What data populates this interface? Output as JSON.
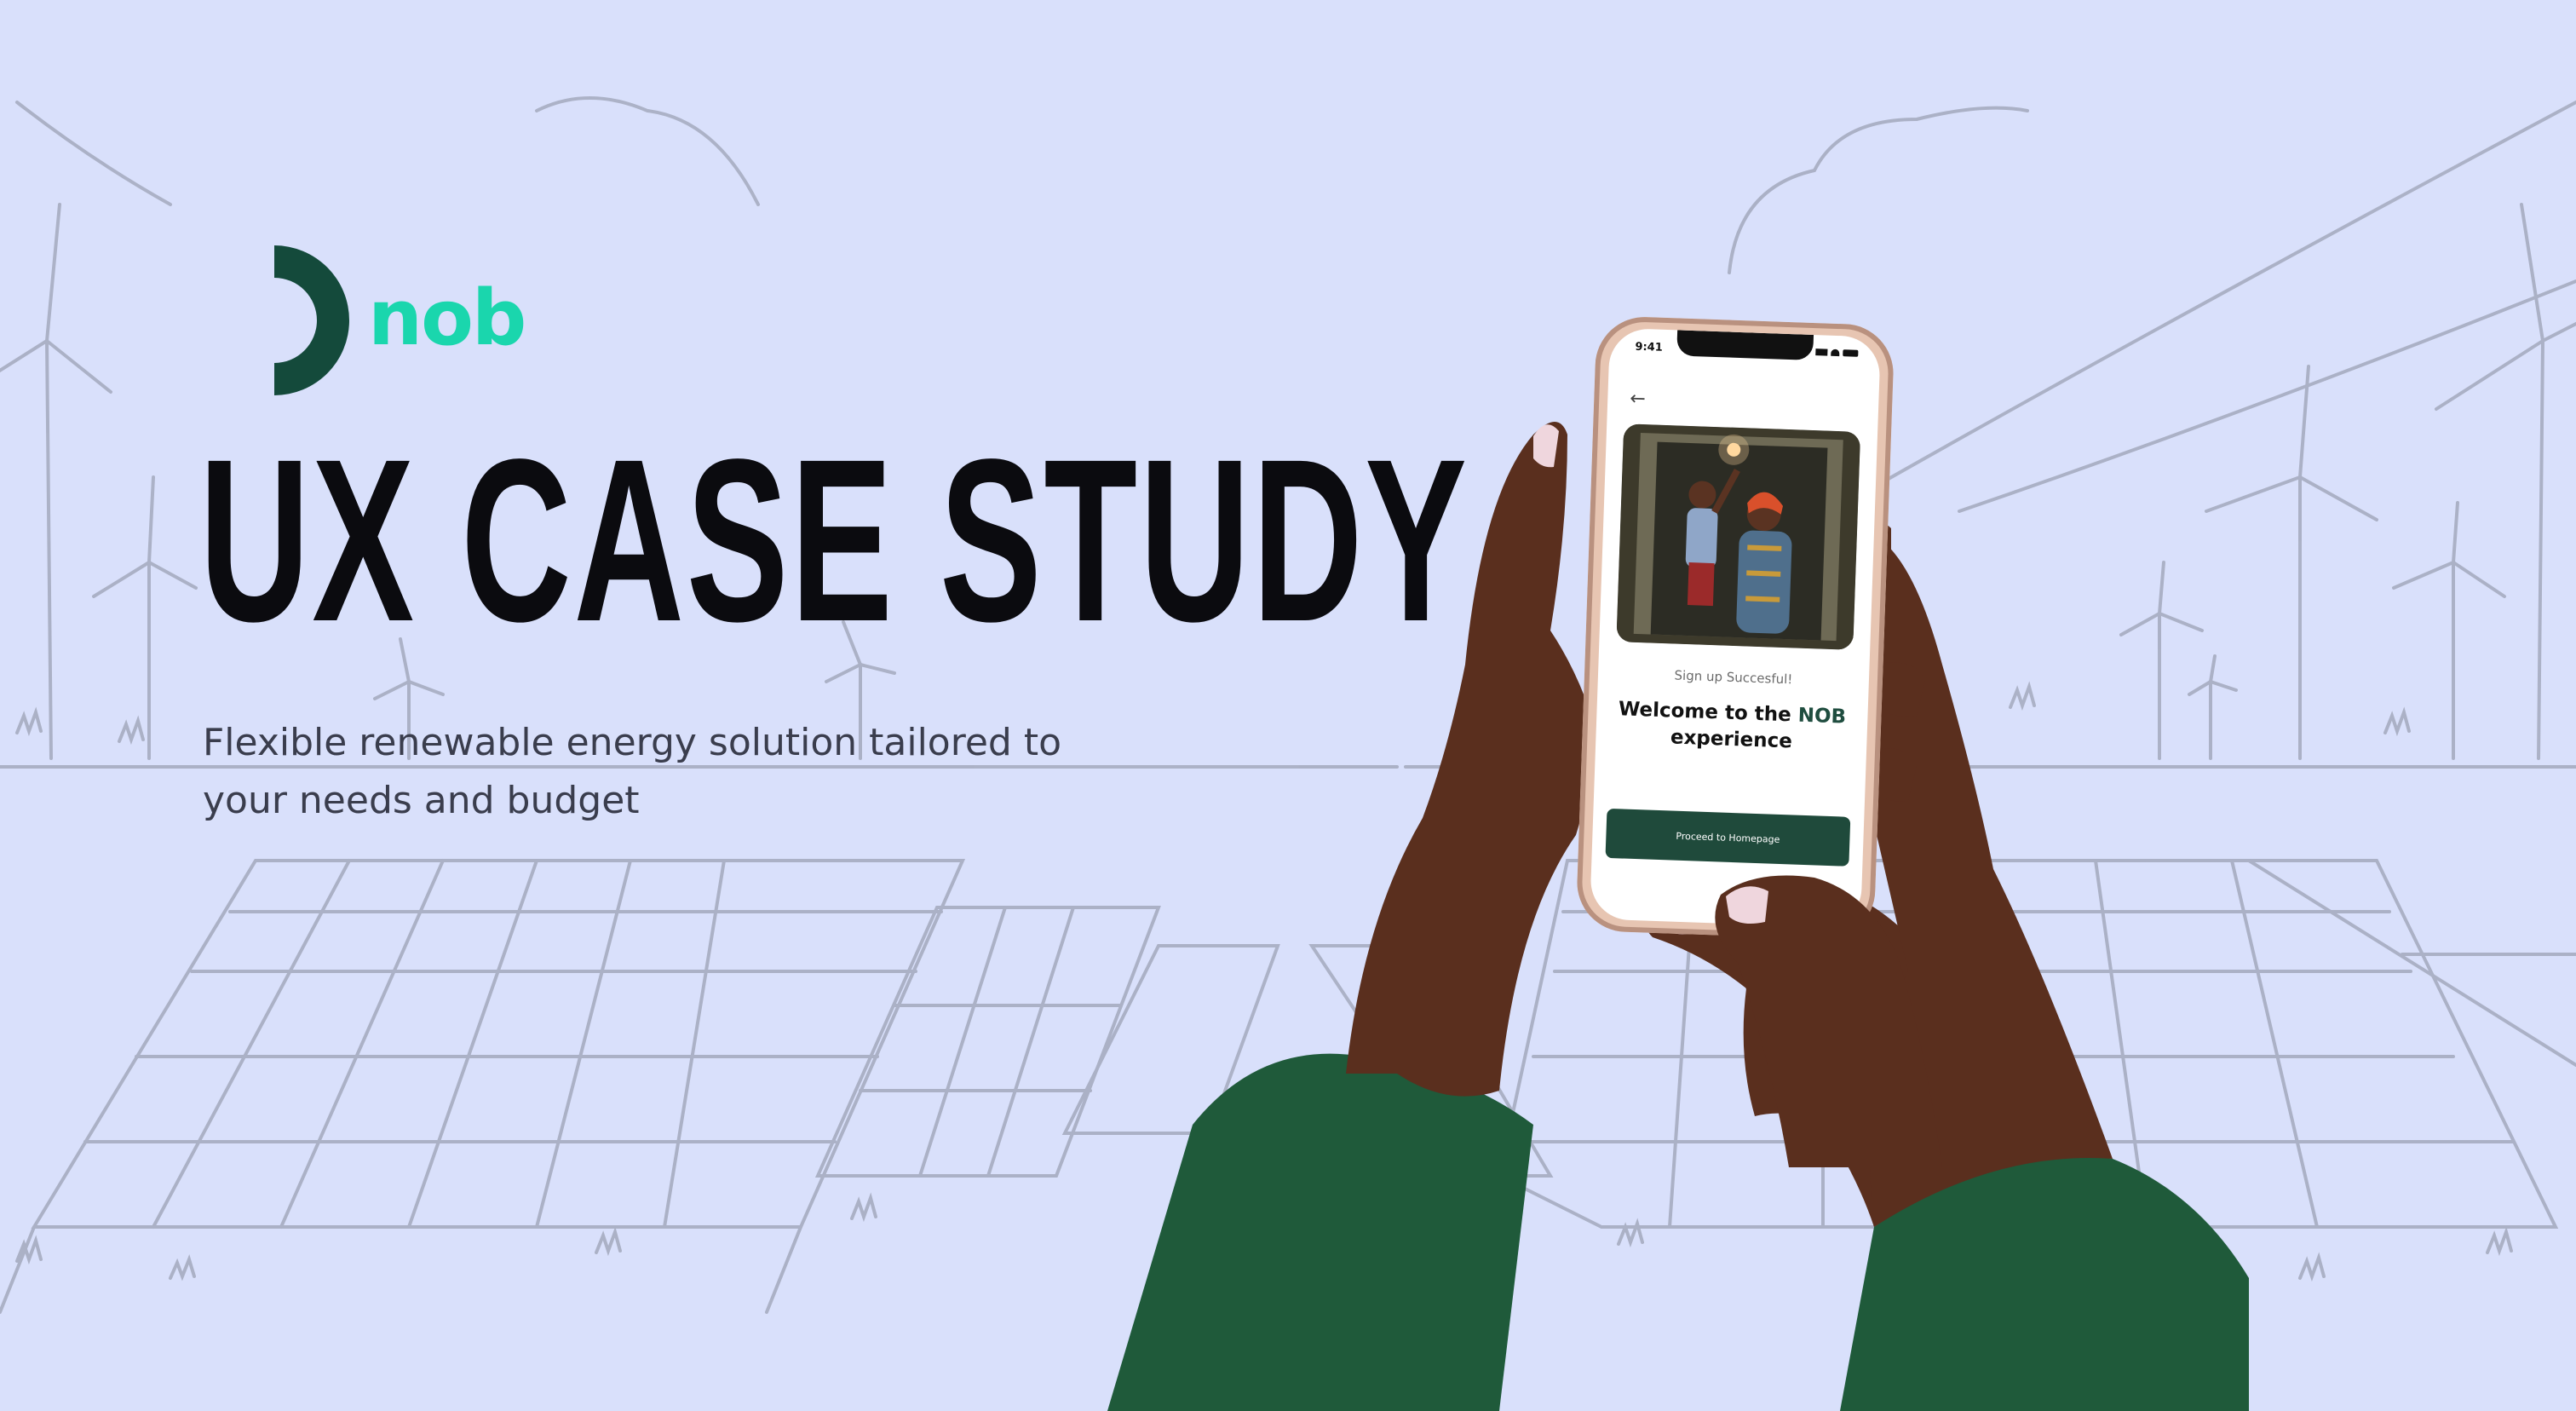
{
  "brand": {
    "name": "nob",
    "mark_color": "#144a3b",
    "word_color": "#1ad6ad"
  },
  "hero": {
    "title": "UX CASE STUDY",
    "subtitle": "Flexible renewable energy solution tailored to your needs and budget"
  },
  "colors": {
    "background": "#d9e0fb",
    "sketch": "#9ea4b8",
    "sleeve": "#1f5a3a",
    "skin": "#5a2f1e"
  },
  "phone": {
    "status_time": "9:41",
    "back_icon": "arrow-left-icon",
    "status_message": "Sign up Succesful!",
    "welcome_prefix": "Welcome to the ",
    "welcome_brand": "NOB",
    "welcome_suffix": "experience",
    "cta_label": "Proceed to Homepage"
  }
}
